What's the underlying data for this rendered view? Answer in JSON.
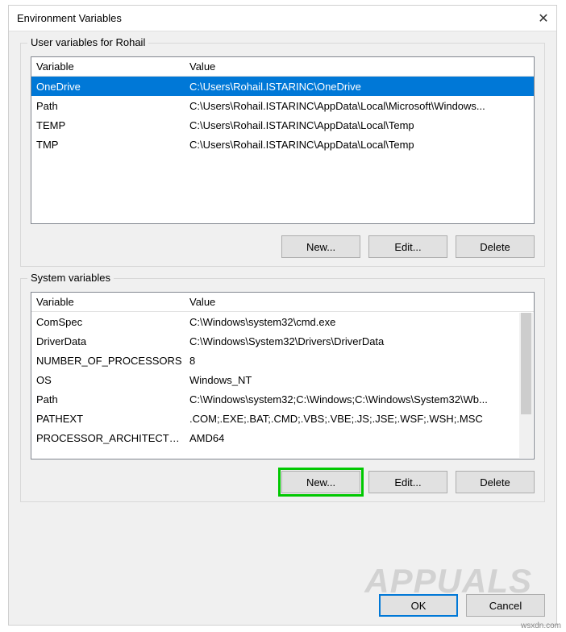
{
  "dialog": {
    "title": "Environment Variables",
    "close_glyph": "✕"
  },
  "user_group": {
    "legend": "User variables for Rohail",
    "headers": {
      "variable": "Variable",
      "value": "Value"
    },
    "rows": [
      {
        "variable": "OneDrive",
        "value": "C:\\Users\\Rohail.ISTARINC\\OneDrive",
        "selected": true
      },
      {
        "variable": "Path",
        "value": "C:\\Users\\Rohail.ISTARINC\\AppData\\Local\\Microsoft\\Windows...",
        "selected": false
      },
      {
        "variable": "TEMP",
        "value": "C:\\Users\\Rohail.ISTARINC\\AppData\\Local\\Temp",
        "selected": false
      },
      {
        "variable": "TMP",
        "value": "C:\\Users\\Rohail.ISTARINC\\AppData\\Local\\Temp",
        "selected": false
      }
    ],
    "buttons": {
      "new": "New...",
      "edit": "Edit...",
      "delete": "Delete"
    }
  },
  "system_group": {
    "legend": "System variables",
    "headers": {
      "variable": "Variable",
      "value": "Value"
    },
    "rows": [
      {
        "variable": "ComSpec",
        "value": "C:\\Windows\\system32\\cmd.exe"
      },
      {
        "variable": "DriverData",
        "value": "C:\\Windows\\System32\\Drivers\\DriverData"
      },
      {
        "variable": "NUMBER_OF_PROCESSORS",
        "value": "8"
      },
      {
        "variable": "OS",
        "value": "Windows_NT"
      },
      {
        "variable": "Path",
        "value": "C:\\Windows\\system32;C:\\Windows;C:\\Windows\\System32\\Wb..."
      },
      {
        "variable": "PATHEXT",
        "value": ".COM;.EXE;.BAT;.CMD;.VBS;.VBE;.JS;.JSE;.WSF;.WSH;.MSC"
      },
      {
        "variable": "PROCESSOR_ARCHITECTU...",
        "value": "AMD64"
      }
    ],
    "buttons": {
      "new": "New...",
      "edit": "Edit...",
      "delete": "Delete"
    }
  },
  "footer": {
    "ok": "OK",
    "cancel": "Cancel"
  },
  "watermark": "APPUALS",
  "credit": "wsxdn.com"
}
